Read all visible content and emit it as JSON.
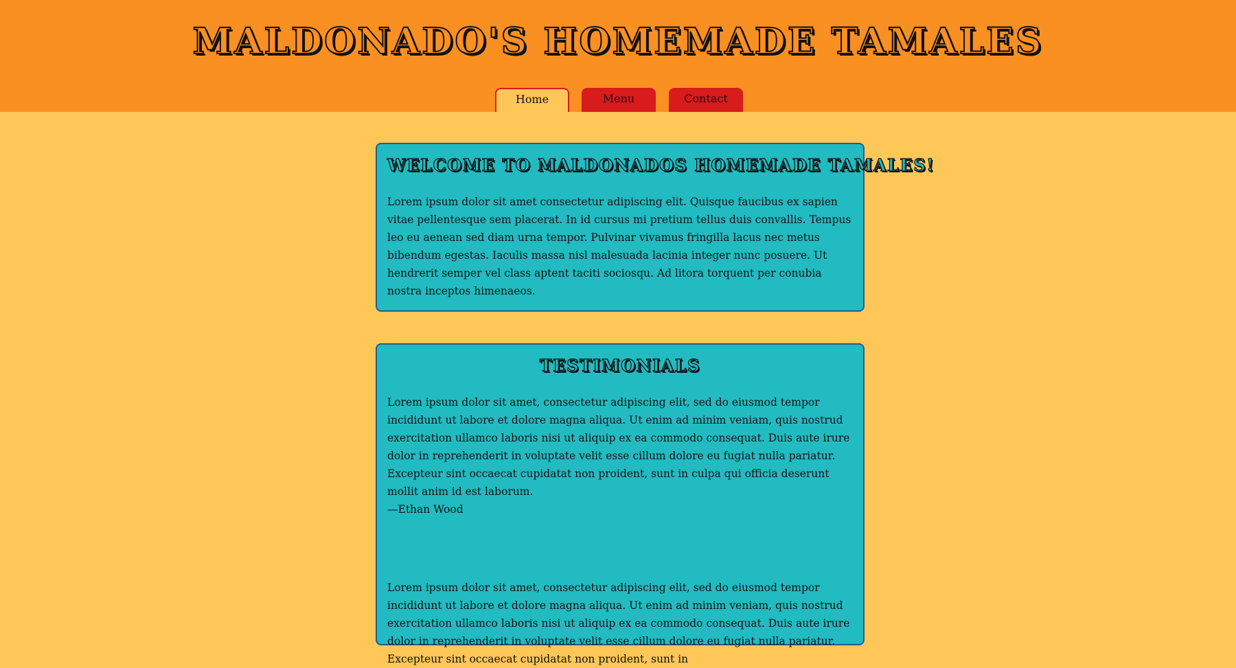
{
  "header": {
    "title": "MALDONADO'S HOMEMADE TAMALES"
  },
  "nav": {
    "tabs": [
      {
        "label": "Home",
        "active": true
      },
      {
        "label": "Menu",
        "active": false
      },
      {
        "label": "Contact",
        "active": false
      }
    ]
  },
  "welcome": {
    "heading": "WELCOME TO MALDONADOS HOMEMADE TAMALES!",
    "body": "Lorem ipsum dolor sit amet consectetur adipiscing elit. Quisque faucibus ex sapien vitae pellentesque sem placerat. In id cursus mi pretium tellus duis convallis. Tempus leo eu aenean sed diam urna tempor. Pulvinar vivamus fringilla lacus nec metus bibendum egestas. Iaculis massa nisl malesuada lacinia integer nunc posuere. Ut hendrerit semper vel class aptent taciti sociosqu. Ad litora torquent per conubia nostra inceptos himenaeos."
  },
  "testimonials": {
    "heading": "TESTIMONIALS",
    "items": [
      {
        "text": "Lorem ipsum dolor sit amet, consectetur adipiscing elit, sed do eiusmod tempor incididunt ut labore et dolore magna aliqua. Ut enim ad minim veniam, quis nostrud exercitation ullamco laboris nisi ut aliquip ex ea commodo consequat. Duis aute irure dolor in reprehenderit in voluptate velit esse cillum dolore eu fugiat nulla pariatur. Excepteur sint occaecat cupidatat non proident, sunt in culpa qui officia deserunt mollit anim id est laborum.",
        "author": "—Ethan Wood"
      },
      {
        "text": "Lorem ipsum dolor sit amet, consectetur adipiscing elit, sed do eiusmod tempor incididunt ut labore et dolore magna aliqua. Ut enim ad minim veniam, quis nostrud exercitation ullamco laboris nisi ut aliquip ex ea commodo consequat. Duis aute irure dolor in reprehenderit in voluptate velit esse cillum dolore eu fugiat nulla pariatur. Excepteur sint occaecat cupidatat non proident, sunt in"
      }
    ]
  },
  "colors": {
    "header_bg": "#fa9022",
    "page_bg": "#ffc658",
    "card_bg": "#21bbc1",
    "card_border": "#205e8a",
    "tab_bg": "#d81b1b"
  }
}
